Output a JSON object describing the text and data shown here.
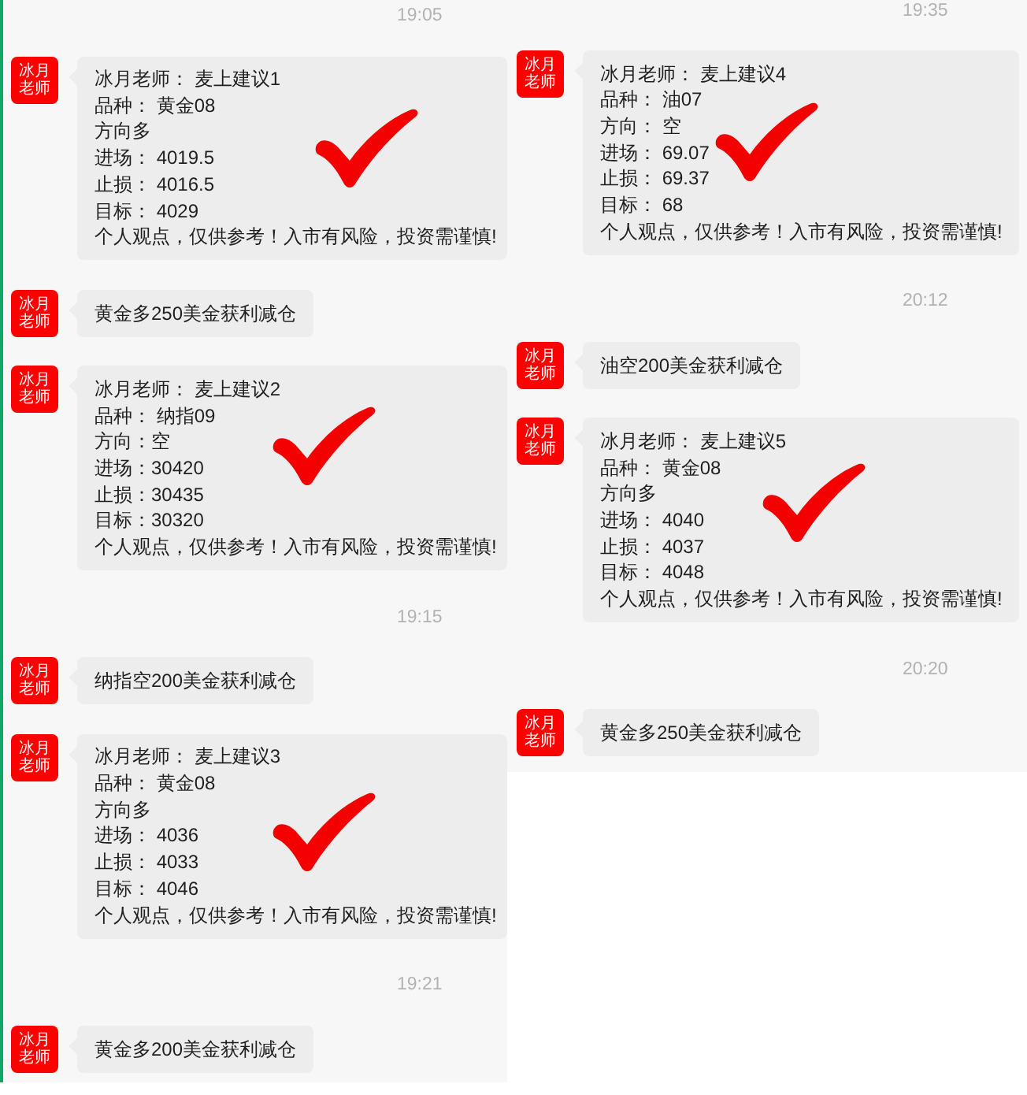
{
  "panels": [
    {
      "items": [
        {
          "kind": "time",
          "text": "19:05"
        },
        {
          "kind": "signal",
          "avatar": "冰月老师",
          "lines": [
            "冰月老师： 麦上建议1",
            "品种： 黄金08",
            "方向多",
            "进场： 4019.5",
            "止损： 4016.5",
            "目标： 4029",
            "个人观点，仅供参考！入市有风险，投资需谨慎!"
          ]
        },
        {
          "kind": "reply",
          "avatar": "冰月老师",
          "text": "黄金多250美金获利减仓"
        },
        {
          "kind": "signal",
          "avatar": "冰月老师",
          "lines": [
            "冰月老师： 麦上建议2",
            "品种： 纳指09",
            "方向：空",
            "进场：30420",
            "止损：30435",
            "目标：30320",
            "个人观点，仅供参考！入市有风险，投资需谨慎!"
          ]
        },
        {
          "kind": "time",
          "text": "19:15"
        },
        {
          "kind": "reply",
          "avatar": "冰月老师",
          "text": "纳指空200美金获利减仓"
        },
        {
          "kind": "signal",
          "avatar": "冰月老师",
          "lines": [
            "冰月老师： 麦上建议3",
            "品种： 黄金08",
            "方向多",
            "进场： 4036",
            "止损： 4033",
            "目标： 4046",
            "个人观点，仅供参考！入市有风险，投资需谨慎!"
          ]
        },
        {
          "kind": "time",
          "text": "19:21"
        },
        {
          "kind": "reply",
          "avatar": "冰月老师",
          "text": "黄金多200美金获利减仓"
        }
      ]
    },
    {
      "items": [
        {
          "kind": "time",
          "text": "19:35"
        },
        {
          "kind": "signal",
          "avatar": "冰月老师",
          "lines": [
            "冰月老师： 麦上建议4",
            "品种： 油07",
            "方向： 空",
            "进场： 69.07",
            "止损： 69.37",
            "目标： 68",
            "个人观点，仅供参考！入市有风险，投资需谨慎!"
          ]
        },
        {
          "kind": "time",
          "text": "20:12"
        },
        {
          "kind": "reply",
          "avatar": "冰月老师",
          "text": "油空200美金获利减仓"
        },
        {
          "kind": "signal",
          "avatar": "冰月老师",
          "lines": [
            "冰月老师： 麦上建议5",
            "品种： 黄金08",
            "方向多",
            "进场： 4040",
            "止损： 4037",
            "目标： 4048",
            "个人观点，仅供参考！入市有风险，投资需谨慎!"
          ]
        },
        {
          "kind": "time",
          "text": "20:20"
        },
        {
          "kind": "reply",
          "avatar": "冰月老师",
          "text": "黄金多250美金获利减仓"
        }
      ]
    }
  ]
}
